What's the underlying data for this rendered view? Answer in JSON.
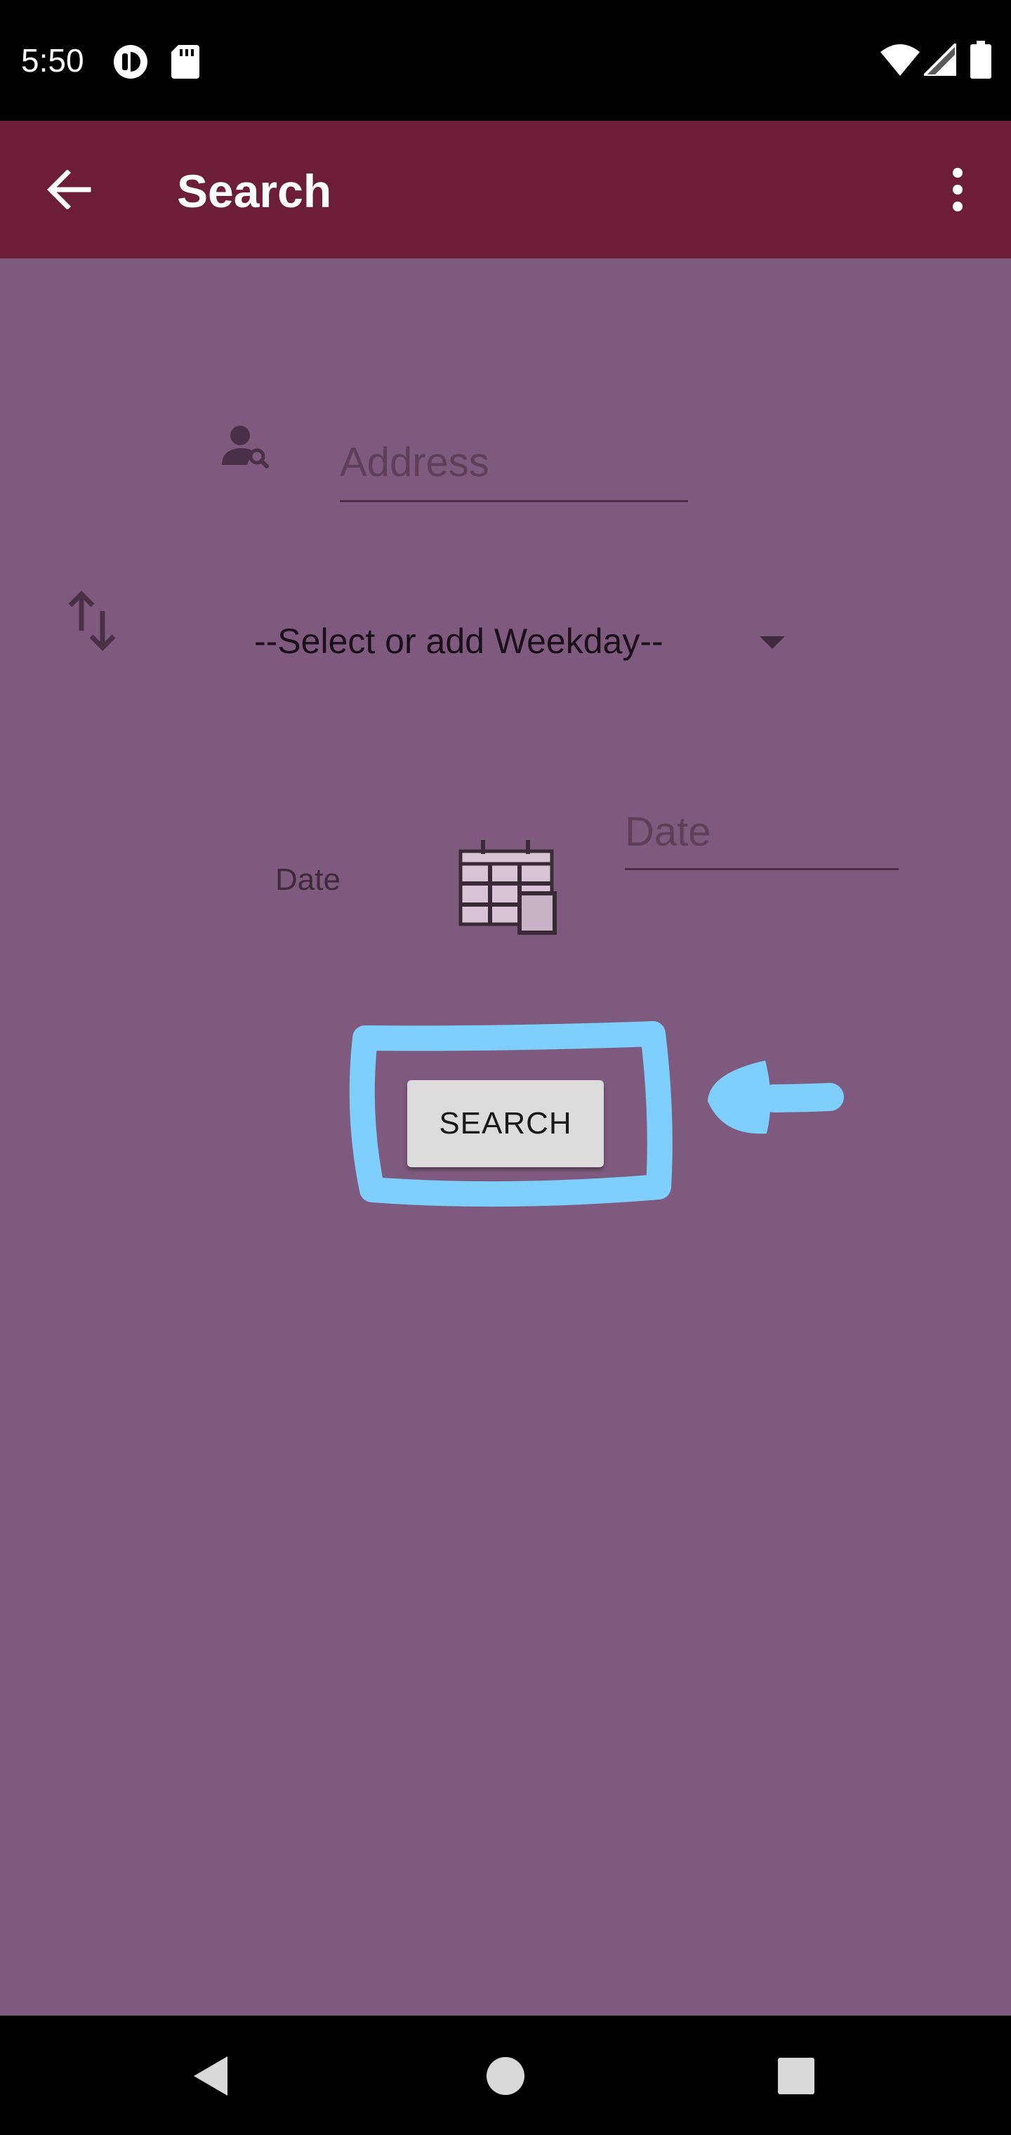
{
  "status_bar": {
    "time": "5:50",
    "left_icons": [
      "circle-app-icon",
      "sd-card-icon"
    ],
    "right_icons": [
      "wifi-icon",
      "signal-icon",
      "battery-icon"
    ]
  },
  "app_bar": {
    "title": "Search",
    "background_color": "#6c1d38",
    "back_icon": "arrow-back-icon",
    "menu_icon": "more-vert-icon"
  },
  "form": {
    "address": {
      "placeholder": "Address",
      "value": "",
      "icon": "person-search-icon"
    },
    "weekday": {
      "selected": "--Select or add Weekday--",
      "icon": "swap-vert-icon"
    },
    "date": {
      "label": "Date",
      "placeholder": "Date",
      "value": "",
      "icon": "calendar-icon"
    },
    "search_button_label": "SEARCH"
  },
  "theme": {
    "content_background": "#7e5b7e",
    "annotation_color": "#7ecffb"
  },
  "nav_bar": {
    "buttons": [
      "back-triangle-icon",
      "home-circle-icon",
      "recents-square-icon"
    ]
  }
}
